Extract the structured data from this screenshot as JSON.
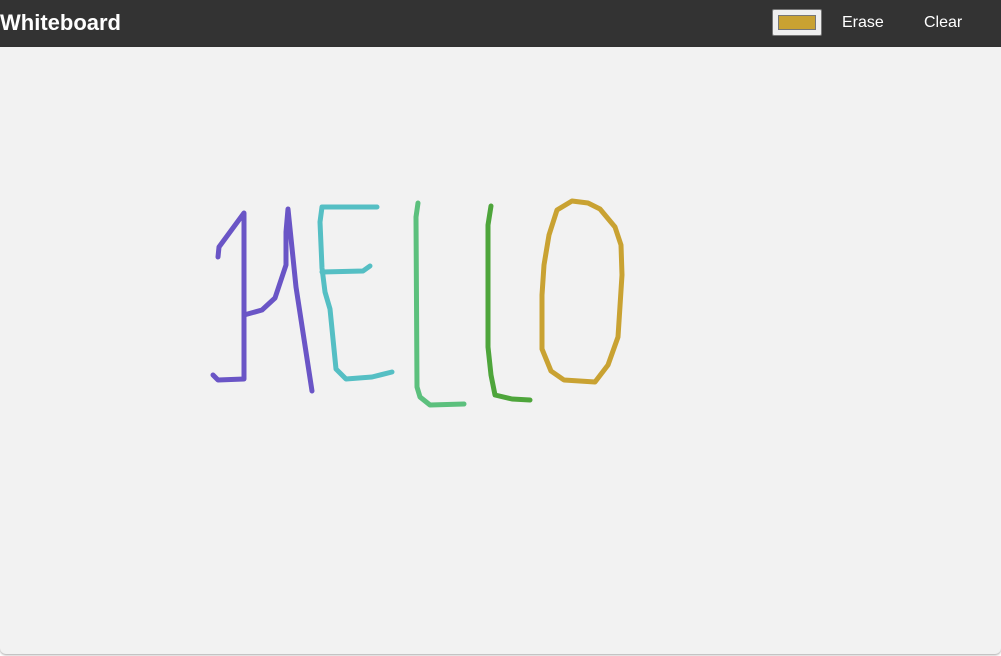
{
  "toolbar": {
    "title": "Whiteboard",
    "current_color": "#c9a232",
    "erase_label": "Erase",
    "clear_label": "Clear"
  },
  "canvas": {
    "background": "#f2f2f2",
    "stroke_colors": {
      "h": "#6a55c6",
      "e": "#55bfc4",
      "l1": "#5cc07d",
      "l2": "#4ea53b",
      "o": "#c9a232"
    }
  }
}
